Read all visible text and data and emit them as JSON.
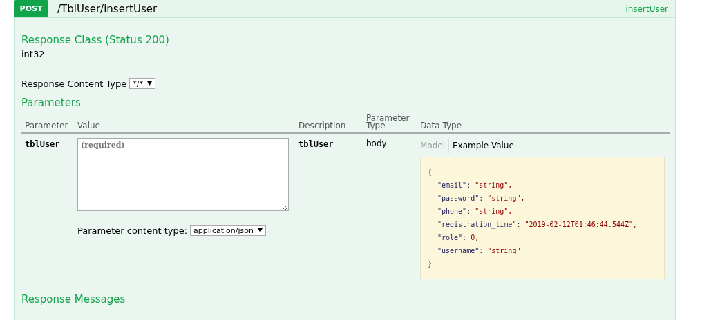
{
  "operation": {
    "method": "POST",
    "path": "/TblUser/insertUser",
    "nickname": "insertUser"
  },
  "response_class": {
    "title": "Response Class (Status 200)",
    "type": "int32"
  },
  "response_content_type": {
    "label": "Response Content Type",
    "value": "*/*"
  },
  "parameters": {
    "title": "Parameters",
    "columns": [
      "Parameter",
      "Value",
      "Description",
      "Parameter Type",
      "Data Type"
    ],
    "rows": [
      {
        "name": "tblUser",
        "placeholder": "(required)",
        "content_type_label": "Parameter content type:",
        "content_type": "application/json",
        "description": "tblUser",
        "parameter_type": "body",
        "data_tabs": [
          {
            "label": "Model",
            "selected": false
          },
          {
            "label": "Example Value",
            "selected": true
          }
        ],
        "example_lines": [
          {
            "kind": "brace",
            "text": "{"
          },
          {
            "kind": "pair",
            "key": "\"email\":",
            "value": "\"string\","
          },
          {
            "kind": "pair",
            "key": "\"password\":",
            "value": "\"string\","
          },
          {
            "kind": "pair",
            "key": "\"phone\":",
            "value": "\"string\","
          },
          {
            "kind": "pair",
            "key": "\"registration_time\":",
            "value": "\"2019-02-12T01:46:44.544Z\","
          },
          {
            "kind": "pair",
            "key": "\"role\":",
            "value": "0,"
          },
          {
            "kind": "pair",
            "key": "\"username\":",
            "value": "\"string\""
          },
          {
            "kind": "brace",
            "text": "}"
          }
        ]
      }
    ]
  },
  "response_messages": {
    "title": "Response Messages"
  }
}
